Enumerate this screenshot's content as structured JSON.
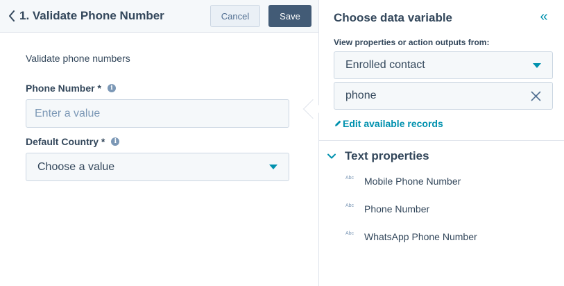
{
  "action_editor": {
    "title": "1. Validate Phone Number",
    "cancel_label": "Cancel",
    "save_label": "Save",
    "description": "Validate phone numbers",
    "fields": [
      {
        "label": "Phone Number *",
        "placeholder": "Enter a value"
      },
      {
        "label": "Default Country *",
        "value": "Choose a value"
      }
    ]
  },
  "variable_panel": {
    "title": "Choose data variable",
    "collapse_glyph": "«",
    "source_label": "View properties or action outputs from:",
    "source_value": "Enrolled contact",
    "search_value": "phone",
    "edit_link": "Edit available records",
    "group": {
      "title": "Text properties",
      "type_badge": "Abc",
      "items": [
        "Mobile Phone Number",
        "Phone Number",
        "WhatsApp Phone Number"
      ]
    }
  },
  "colors": {
    "text": "#33475b",
    "accent": "#0091ae",
    "primary_button": "#425b76",
    "input_bg": "#f5f8fa",
    "border": "#cbd6e2",
    "placeholder": "#7c98b6"
  },
  "icons": [
    "back-chevron-icon",
    "info-icon",
    "caret-down-icon",
    "double-chevron-left-icon",
    "close-icon",
    "pencil-icon",
    "chevron-down-icon"
  ]
}
